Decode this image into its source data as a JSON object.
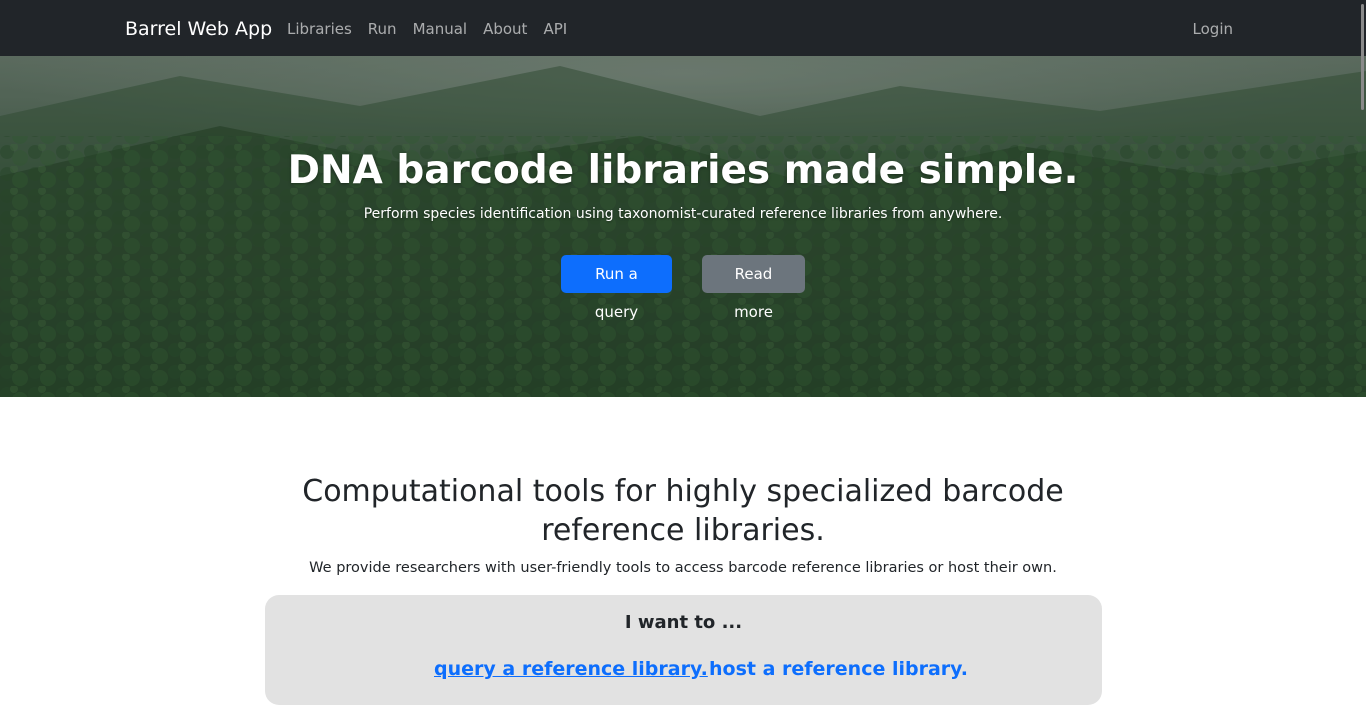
{
  "navbar": {
    "brand": "Barrel Web App",
    "links": [
      "Libraries",
      "Run",
      "Manual",
      "About",
      "API"
    ],
    "login": "Login"
  },
  "hero": {
    "title": "DNA barcode libraries made simple.",
    "subtitle": "Perform species identification using taxonomist-curated reference libraries from anywhere.",
    "primary_button": "Run a query",
    "secondary_button": "Read more"
  },
  "intro": {
    "title": "Computational tools for highly specialized barcode reference libraries.",
    "text": "We provide researchers with user-friendly tools to access barcode reference libraries or host their own."
  },
  "choice_card": {
    "title": "I want to ...",
    "options": [
      "query a reference library.",
      "host a reference library."
    ]
  },
  "colors": {
    "navbar_bg": "#212529",
    "primary": "#0d6efd",
    "secondary": "#6c757d",
    "card_bg": "#e2e2e2"
  }
}
